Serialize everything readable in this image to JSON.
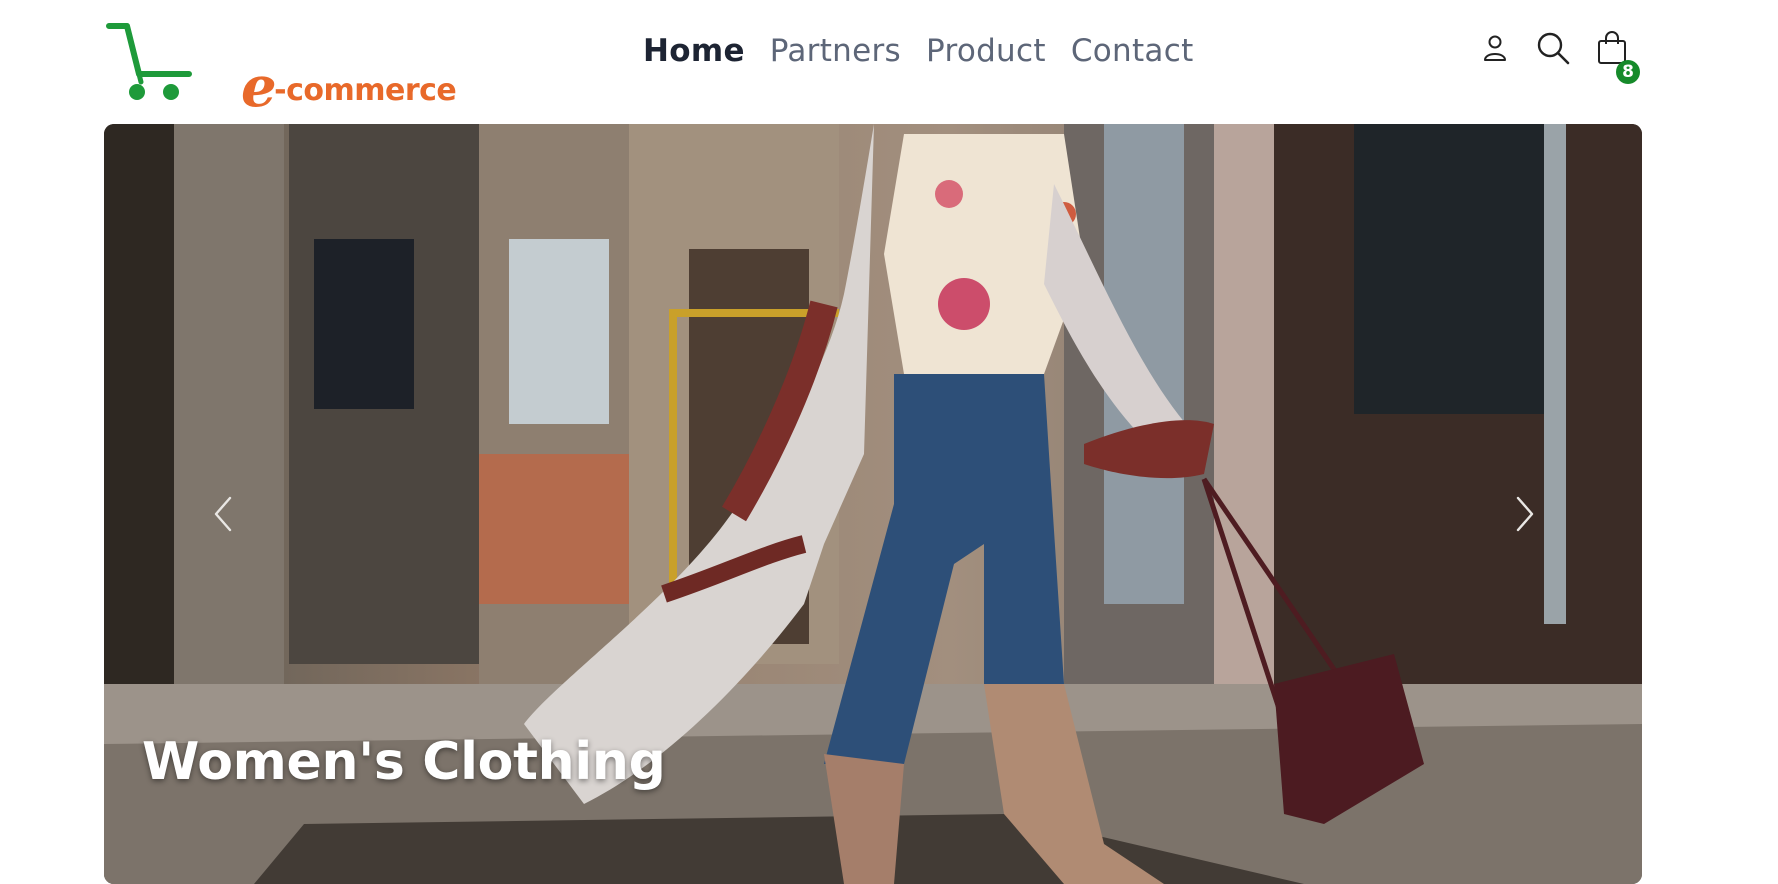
{
  "brand": {
    "logo_text": "e-commerce",
    "logo_big_letter": "e",
    "logo_rest": "-commerce",
    "accent_color": "#e8692a",
    "cart_color": "#1e9a3a"
  },
  "nav": {
    "items": [
      {
        "label": "Home",
        "active": true
      },
      {
        "label": "Partners",
        "active": false
      },
      {
        "label": "Product",
        "active": false
      },
      {
        "label": "Contact",
        "active": false
      }
    ]
  },
  "header_icons": {
    "user": "user-icon",
    "search": "search-icon",
    "cart": "shopping-bag-icon",
    "cart_count": "8",
    "badge_color": "#168a2a"
  },
  "hero": {
    "caption": "Women's Clothing",
    "prev_icon": "chevron-left-icon",
    "next_icon": "chevron-right-icon"
  }
}
